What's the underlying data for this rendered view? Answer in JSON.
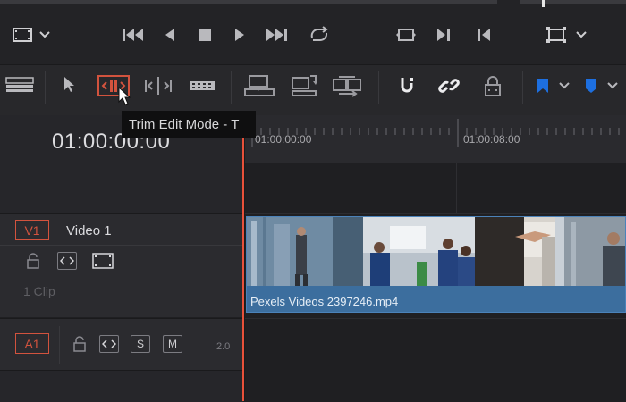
{
  "tooltip": {
    "text": "Trim Edit Mode - T"
  },
  "timeline": {
    "timecode": "01:00:00:00",
    "ruler_labels": [
      "01:00:00:00",
      "01:00:08:00"
    ]
  },
  "tracks": {
    "video": {
      "id": "V1",
      "name": "Video 1",
      "clip_count": "1 Clip"
    },
    "audio": {
      "id": "A1",
      "solo_label": "S",
      "mute_label": "M",
      "level": "2.0"
    }
  },
  "clip": {
    "label": "Pexels Videos 2397246.mp4"
  },
  "colors": {
    "accent_red": "#e8513a",
    "clip_blue": "#3c6e9e",
    "flag_blue": "#1d6fe0"
  },
  "icons": {
    "top": [
      "monitor-icon",
      "chevron-down-icon",
      "skip-back-icon",
      "reverse-play-icon",
      "stop-icon",
      "play-icon",
      "skip-forward-icon",
      "loop-icon",
      "match-frame-icon",
      "next-edit-icon",
      "prev-edit-icon",
      "viewer-frame-icon"
    ],
    "toolbar": [
      "timeline-view-icon",
      "pointer-icon",
      "trim-edit-icon",
      "dynamic-trim-icon",
      "blade-icon",
      "insert-icon",
      "overwrite-icon",
      "replace-icon",
      "snapping-icon",
      "linked-selection-icon",
      "position-lock-icon",
      "flag-icon",
      "marker-icon"
    ]
  }
}
